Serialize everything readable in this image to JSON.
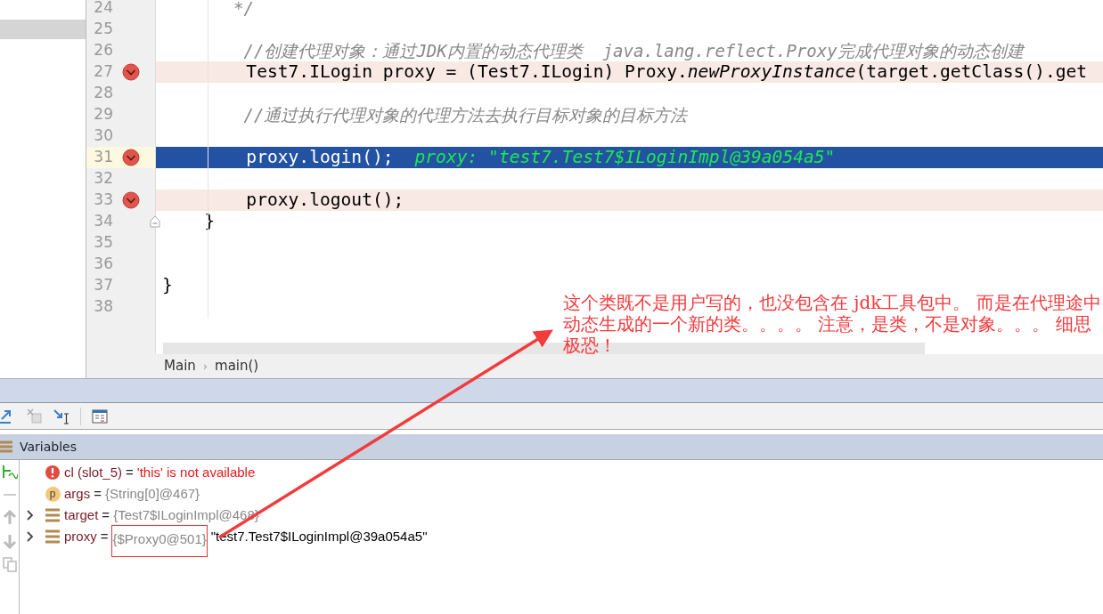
{
  "editor": {
    "lines": [
      {
        "number": "24",
        "kind": "comment",
        "code": "       */",
        "breakpoint": false,
        "current": false
      },
      {
        "number": "25",
        "kind": "blank",
        "breakpoint": false,
        "current": false
      },
      {
        "number": "26",
        "kind": "comment",
        "code": "        //创建代理对象：通过JDK内置的动态代理类  java.lang.reflect.Proxy完成代理对象的动态创建",
        "breakpoint": false,
        "current": false
      },
      {
        "number": "27",
        "kind": "code",
        "code": "        Test7.ILogin proxy = (Test7.ILogin) Proxy.*newProxyInstance*(target.getClass().get",
        "breakpoint": true,
        "current": false
      },
      {
        "number": "28",
        "kind": "blank",
        "breakpoint": false,
        "current": false
      },
      {
        "number": "29",
        "kind": "comment",
        "code": "        //通过执行代理对象的代理方法去执行目标对象的目标方法",
        "breakpoint": false,
        "current": false
      },
      {
        "number": "30",
        "kind": "blank",
        "breakpoint": false,
        "current": false
      },
      {
        "number": "31",
        "kind": "code",
        "code": "        proxy.login();",
        "inline_value": "proxy: \"test7.Test7$ILoginImpl@39a054a5\"",
        "breakpoint": true,
        "current": true
      },
      {
        "number": "32",
        "kind": "blank",
        "breakpoint": false,
        "current": false
      },
      {
        "number": "33",
        "kind": "code",
        "code": "        proxy.logout();",
        "breakpoint": true,
        "current": false
      },
      {
        "number": "34",
        "kind": "code",
        "code": "    }",
        "breakpoint": false,
        "current": false,
        "fold_marker": true
      },
      {
        "number": "35",
        "kind": "blank",
        "breakpoint": false,
        "current": false
      },
      {
        "number": "36",
        "kind": "blank",
        "breakpoint": false,
        "current": false
      },
      {
        "number": "37",
        "kind": "code",
        "code": "}",
        "breakpoint": false,
        "current": false
      },
      {
        "number": "38",
        "kind": "blank",
        "breakpoint": false,
        "current": false
      }
    ]
  },
  "breadcrumb": {
    "items": [
      "Main",
      "main()"
    ],
    "separator": "›"
  },
  "debug_panel": {
    "title": "Variables",
    "variables": [
      {
        "kind": "error",
        "expandable": false,
        "name": "cl (slot_5)",
        "equals": "=",
        "value": "'this' is not available",
        "boxed": false
      },
      {
        "kind": "param",
        "badge": "p",
        "expandable": false,
        "name": "args",
        "equals": "=",
        "value": "{String[0]@467}",
        "boxed": false
      },
      {
        "kind": "field",
        "expandable": true,
        "name": "target",
        "equals": "=",
        "value": "{Test7$ILoginImpl@468}",
        "boxed": false
      },
      {
        "kind": "field",
        "expandable": true,
        "name": "proxy",
        "equals": "=",
        "value": "{$Proxy0@501}",
        "boxed": true,
        "string_value": "\"test7.Test7$ILoginImpl@39a054a5\""
      }
    ]
  },
  "annotation": {
    "text": "这个类既不是用户写的，也没包含在 jdk工具包中。 而是在代理途中动态生成的一个新的类。。。。 注意，是类，不是对象。。。 细思极恐！"
  }
}
